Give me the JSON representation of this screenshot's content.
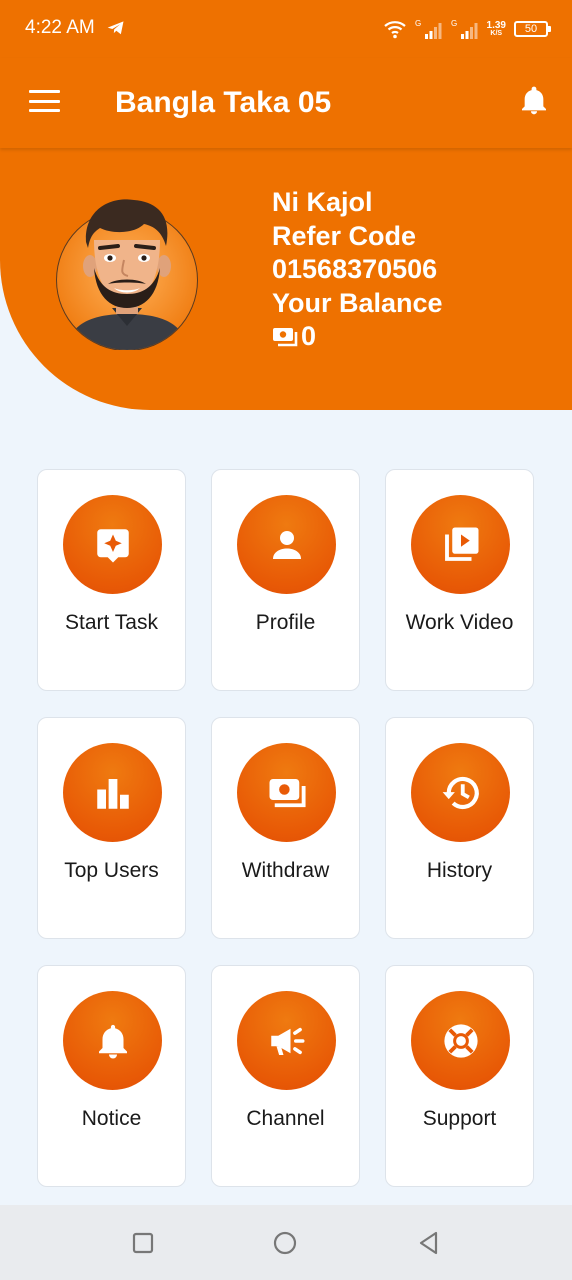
{
  "status_bar": {
    "time": "4:22 AM",
    "network_speed_value": "1.39",
    "network_speed_unit": "K/S",
    "signal_label": "G",
    "battery": "50"
  },
  "app_bar": {
    "title": "Bangla Taka 05"
  },
  "profile": {
    "name": "Ni Kajol",
    "refer_code_label": "Refer Code",
    "refer_code": "01568370506",
    "balance_label": "Your Balance",
    "balance": "0"
  },
  "menu": [
    {
      "label": "Start Task",
      "icon": "task-star-icon"
    },
    {
      "label": "Profile",
      "icon": "person-icon"
    },
    {
      "label": "Work Video",
      "icon": "video-library-icon"
    },
    {
      "label": "Top Users",
      "icon": "bar-chart-icon"
    },
    {
      "label": "Withdraw",
      "icon": "money-icon"
    },
    {
      "label": "History",
      "icon": "history-icon"
    },
    {
      "label": "Notice",
      "icon": "bell-icon"
    },
    {
      "label": "Channel",
      "icon": "megaphone-icon"
    },
    {
      "label": "Support",
      "icon": "lifebuoy-icon"
    }
  ],
  "colors": {
    "primary": "#ee7100",
    "circle": "#e85a06",
    "background": "#eef5fc",
    "nav": "#e9ebee"
  }
}
